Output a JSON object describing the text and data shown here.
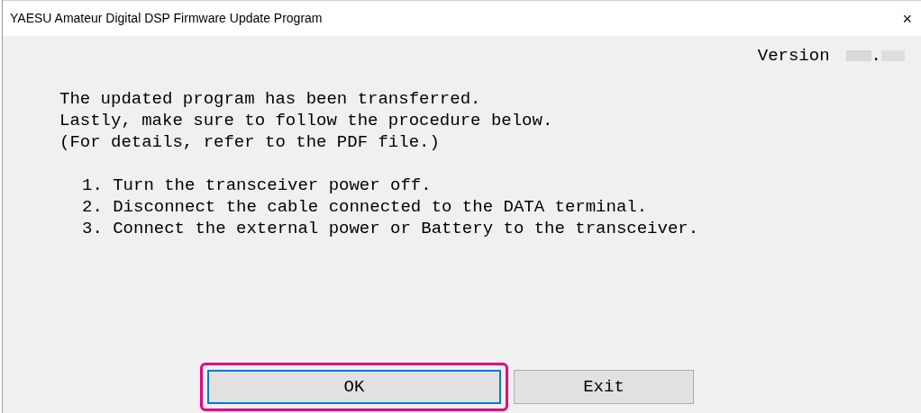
{
  "window": {
    "title": "YAESU Amateur Digital DSP Firmware Update Program",
    "close": "×"
  },
  "version": {
    "label": "Version",
    "separator": "."
  },
  "message": [
    "The updated program has been transferred.",
    "Lastly, make sure to follow the procedure below.",
    "(For details, refer to the PDF file.)"
  ],
  "steps": [
    "1. Turn the transceiver power off.",
    "2. Disconnect the cable connected to the DATA terminal.",
    "3. Connect the external power or Battery to the transceiver."
  ],
  "buttons": [
    {
      "label": "OK",
      "focused": true,
      "highlighted": true
    },
    {
      "label": "Exit",
      "focused": false,
      "highlighted": false
    }
  ]
}
